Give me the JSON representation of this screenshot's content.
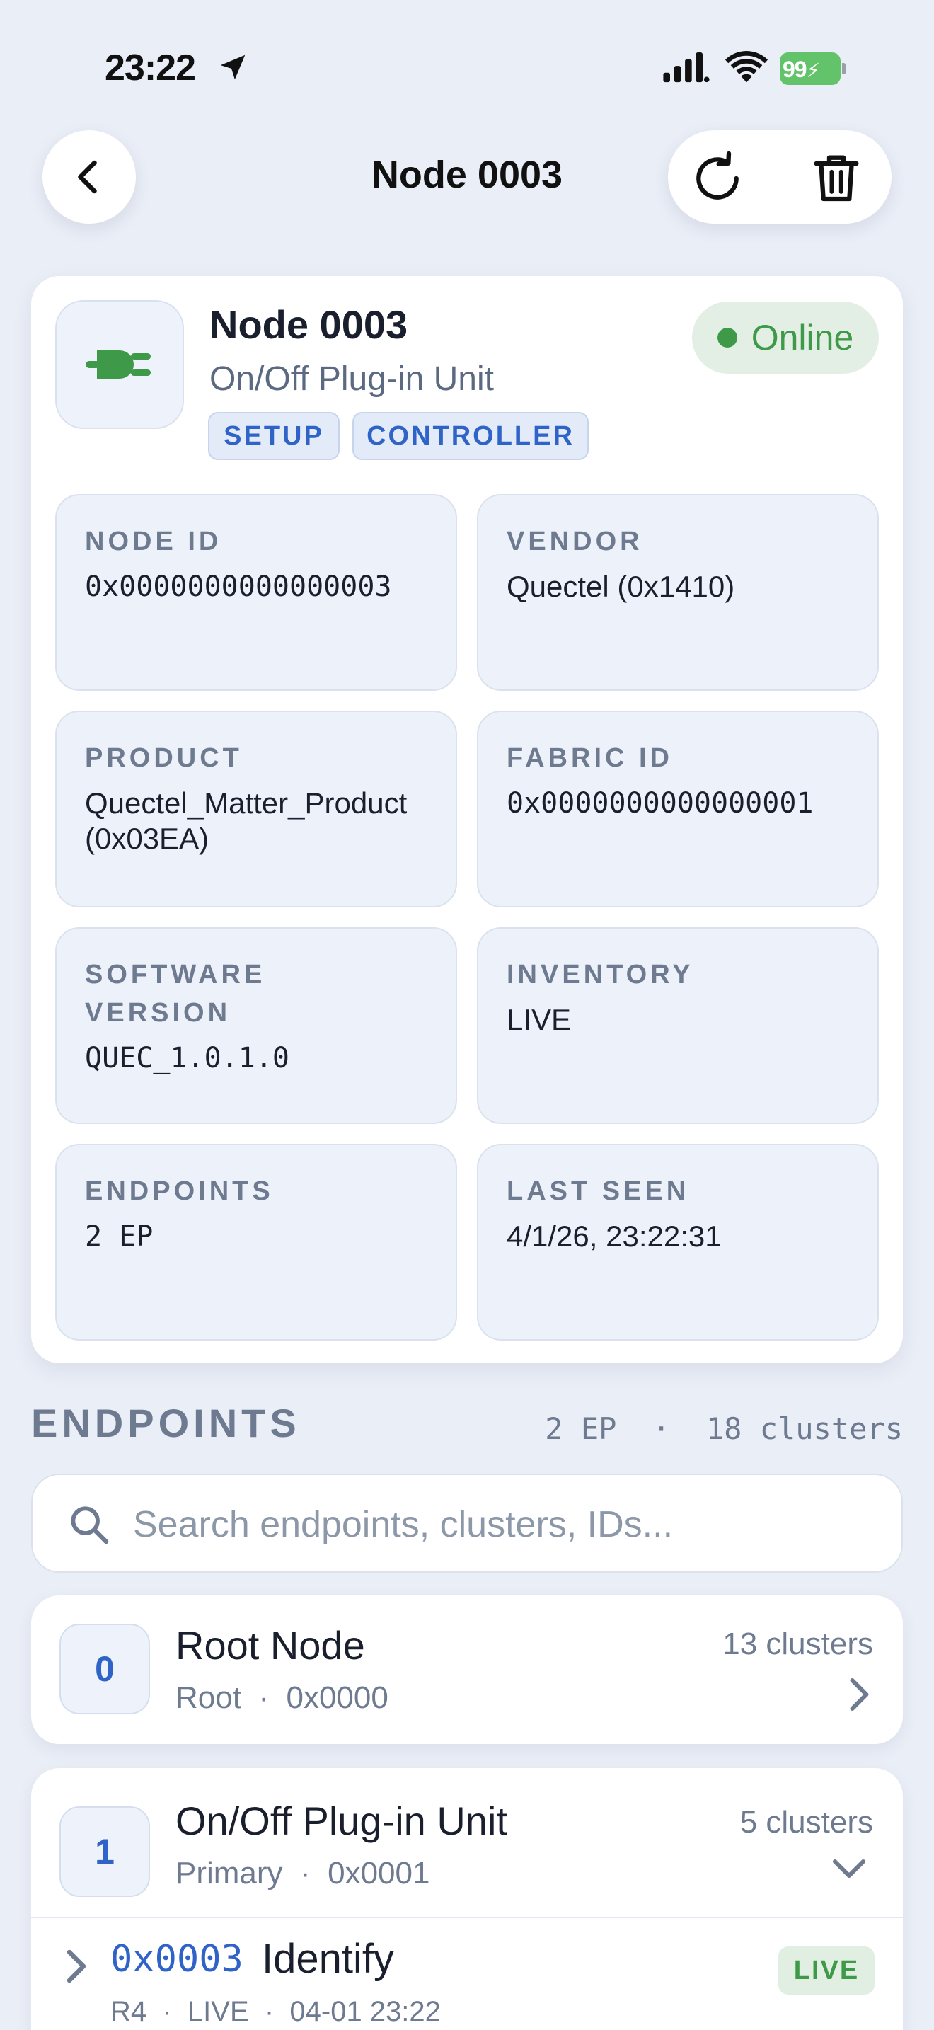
{
  "status_bar": {
    "time": "23:22",
    "battery": "99"
  },
  "nav": {
    "title": "Node 0003"
  },
  "device": {
    "title": "Node 0003",
    "subtitle": "On/Off Plug-in Unit",
    "tags": [
      "SETUP",
      "CONTROLLER"
    ],
    "status": "Online",
    "icon": "plug-icon",
    "accent_color": "#3e9a48"
  },
  "info_tiles": [
    {
      "label": "NODE ID",
      "value": "0x0000000000000003"
    },
    {
      "label": "VENDOR",
      "value": "Quectel (0x1410)"
    },
    {
      "label": "PRODUCT",
      "value": "Quectel_Matter_Product (0x03EA)"
    },
    {
      "label": "FABRIC ID",
      "value": "0x0000000000000001"
    },
    {
      "label": "SOFTWARE VERSION",
      "value": "QUEC_1.0.1.0"
    },
    {
      "label": "INVENTORY",
      "value": "LIVE"
    },
    {
      "label": "ENDPOINTS",
      "value": "2 EP"
    },
    {
      "label": "LAST SEEN",
      "value": "4/1/26, 23:22:31"
    }
  ],
  "endpoints": {
    "heading": "ENDPOINTS",
    "summary": "2 EP  ·  18 clusters",
    "search": {
      "placeholder": "Search endpoints, clusters, IDs...",
      "value": ""
    },
    "items": [
      {
        "number": "0",
        "name": "Root Node",
        "meta": "Root  ·  0x0000",
        "clusters": "13 clusters",
        "expanded": false
      },
      {
        "number": "1",
        "name": "On/Off Plug-in Unit",
        "meta": "Primary  ·  0x0001",
        "clusters": "5 clusters",
        "expanded": true,
        "cluster_rows": [
          {
            "id": "0x0003",
            "name": "Identify",
            "meta": "R4  ·  LIVE  ·  04-01 23:22",
            "badge": "LIVE"
          }
        ]
      }
    ]
  }
}
